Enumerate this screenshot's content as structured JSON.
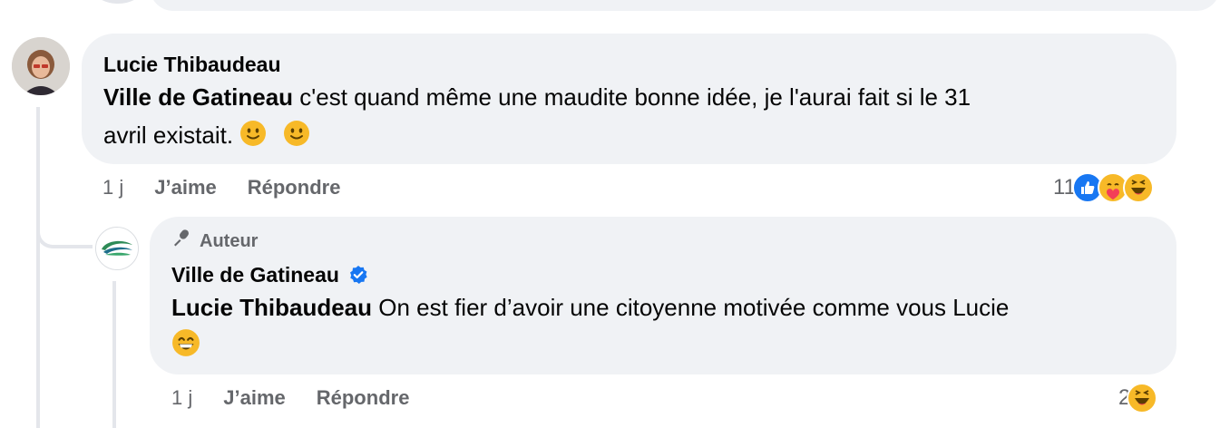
{
  "comments": [
    {
      "author": "Lucie Thibaudeau",
      "mention": "Ville de Gatineau",
      "text_line1": " c'est quand même une maudite bonne idée, je l'aurai fait si le 31",
      "text_line2": "avril existait. ",
      "emojis": [
        "slightly-smiling-face",
        "slightly-smiling-face"
      ],
      "time": "1 j",
      "like_label": "J’aime",
      "reply_label": "Répondre",
      "reaction_count": "11",
      "reactions": [
        "like",
        "care",
        "haha"
      ]
    },
    {
      "badge": "Auteur",
      "author": "Ville de Gatineau",
      "verified": true,
      "mention": "Lucie Thibaudeau",
      "text_line1": " On est fier d’avoir une citoyenne motivée comme vous Lucie",
      "emojis": [
        "grinning-face-with-smiling-eyes"
      ],
      "time": "1 j",
      "like_label": "J’aime",
      "reply_label": "Répondre",
      "reaction_count": "2",
      "reactions": [
        "haha"
      ]
    }
  ],
  "colors": {
    "bubble": "#f0f2f5",
    "secondary_text": "#65676b",
    "like_blue": "#1877f2",
    "verified_blue": "#1877f2",
    "emoji_yellow": "#f7b928"
  }
}
